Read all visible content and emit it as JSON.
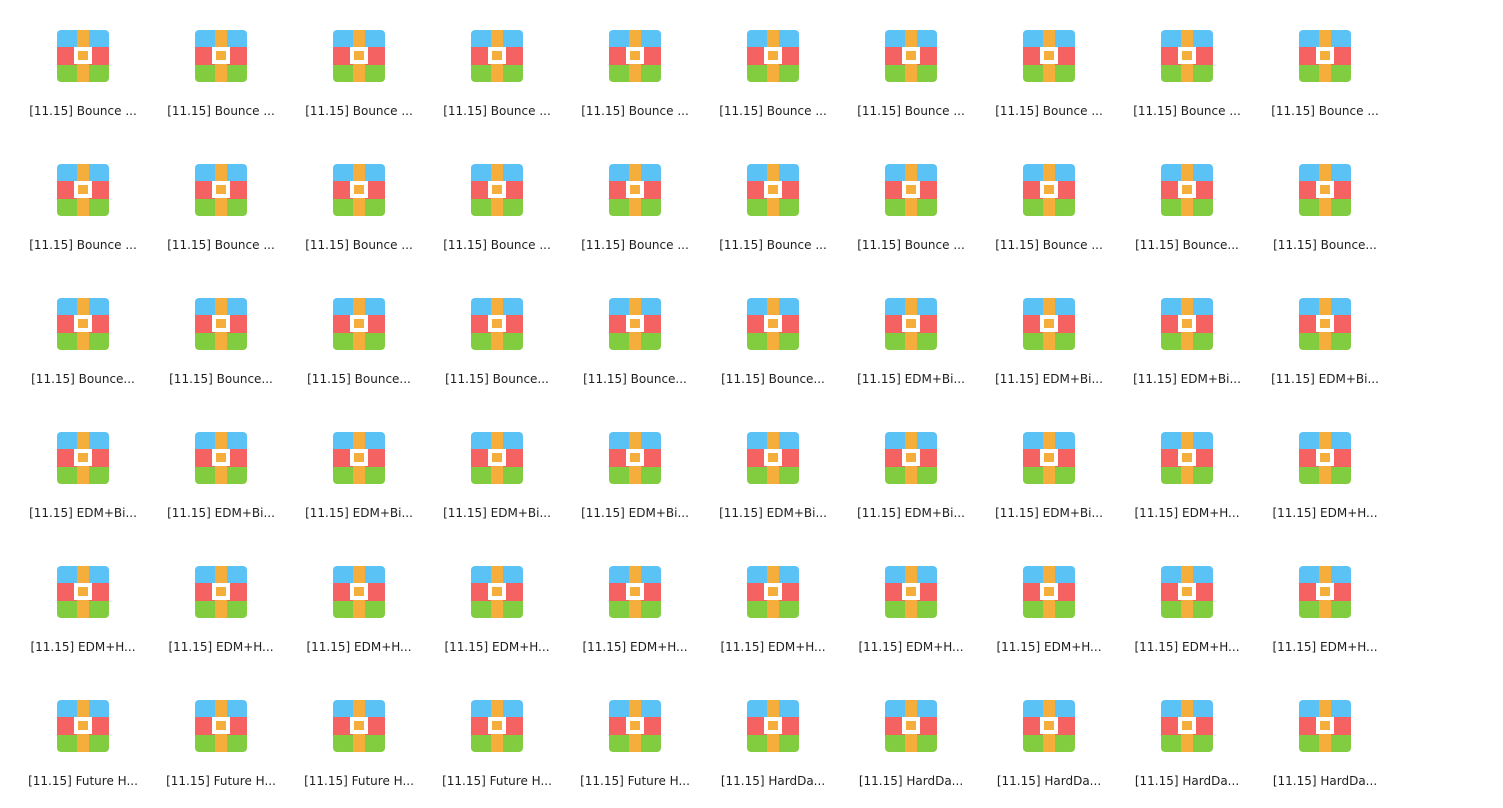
{
  "icon": "winrar-archive-icon",
  "colors": {
    "band_top": "#5bc2f5",
    "band_middle": "#f56262",
    "band_bottom": "#82cd3f",
    "strap": "#f5ad3b",
    "buckle_fill": "#ffffff",
    "label_text": "#1e1e1e"
  },
  "files": [
    {
      "name": "[11.15] Bounce ..."
    },
    {
      "name": "[11.15] Bounce ..."
    },
    {
      "name": "[11.15] Bounce ..."
    },
    {
      "name": "[11.15] Bounce ..."
    },
    {
      "name": "[11.15] Bounce ..."
    },
    {
      "name": "[11.15] Bounce ..."
    },
    {
      "name": "[11.15] Bounce ..."
    },
    {
      "name": "[11.15] Bounce ..."
    },
    {
      "name": "[11.15] Bounce ..."
    },
    {
      "name": "[11.15] Bounce ..."
    },
    {
      "name": "[11.15] Bounce ..."
    },
    {
      "name": "[11.15] Bounce ..."
    },
    {
      "name": "[11.15] Bounce ..."
    },
    {
      "name": "[11.15] Bounce ..."
    },
    {
      "name": "[11.15] Bounce ..."
    },
    {
      "name": "[11.15] Bounce ..."
    },
    {
      "name": "[11.15] Bounce ..."
    },
    {
      "name": "[11.15] Bounce ..."
    },
    {
      "name": "[11.15] Bounce..."
    },
    {
      "name": "[11.15] Bounce..."
    },
    {
      "name": "[11.15] Bounce..."
    },
    {
      "name": "[11.15] Bounce..."
    },
    {
      "name": "[11.15] Bounce..."
    },
    {
      "name": "[11.15] Bounce..."
    },
    {
      "name": "[11.15] Bounce..."
    },
    {
      "name": "[11.15] Bounce..."
    },
    {
      "name": "[11.15] EDM+Bi..."
    },
    {
      "name": "[11.15] EDM+Bi..."
    },
    {
      "name": "[11.15] EDM+Bi..."
    },
    {
      "name": "[11.15] EDM+Bi..."
    },
    {
      "name": "[11.15] EDM+Bi..."
    },
    {
      "name": "[11.15] EDM+Bi..."
    },
    {
      "name": "[11.15] EDM+Bi..."
    },
    {
      "name": "[11.15] EDM+Bi..."
    },
    {
      "name": "[11.15] EDM+Bi..."
    },
    {
      "name": "[11.15] EDM+Bi..."
    },
    {
      "name": "[11.15] EDM+Bi..."
    },
    {
      "name": "[11.15] EDM+Bi..."
    },
    {
      "name": "[11.15] EDM+H..."
    },
    {
      "name": "[11.15] EDM+H..."
    },
    {
      "name": "[11.15] EDM+H..."
    },
    {
      "name": "[11.15] EDM+H..."
    },
    {
      "name": "[11.15] EDM+H..."
    },
    {
      "name": "[11.15] EDM+H..."
    },
    {
      "name": "[11.15] EDM+H..."
    },
    {
      "name": "[11.15] EDM+H..."
    },
    {
      "name": "[11.15] EDM+H..."
    },
    {
      "name": "[11.15] EDM+H..."
    },
    {
      "name": "[11.15] EDM+H..."
    },
    {
      "name": "[11.15] EDM+H..."
    },
    {
      "name": "[11.15] Future H..."
    },
    {
      "name": "[11.15] Future H..."
    },
    {
      "name": "[11.15] Future H..."
    },
    {
      "name": "[11.15] Future H..."
    },
    {
      "name": "[11.15] Future H..."
    },
    {
      "name": "[11.15] HardDa..."
    },
    {
      "name": "[11.15] HardDa..."
    },
    {
      "name": "[11.15] HardDa..."
    },
    {
      "name": "[11.15] HardDa..."
    },
    {
      "name": "[11.15] HardDa..."
    }
  ]
}
